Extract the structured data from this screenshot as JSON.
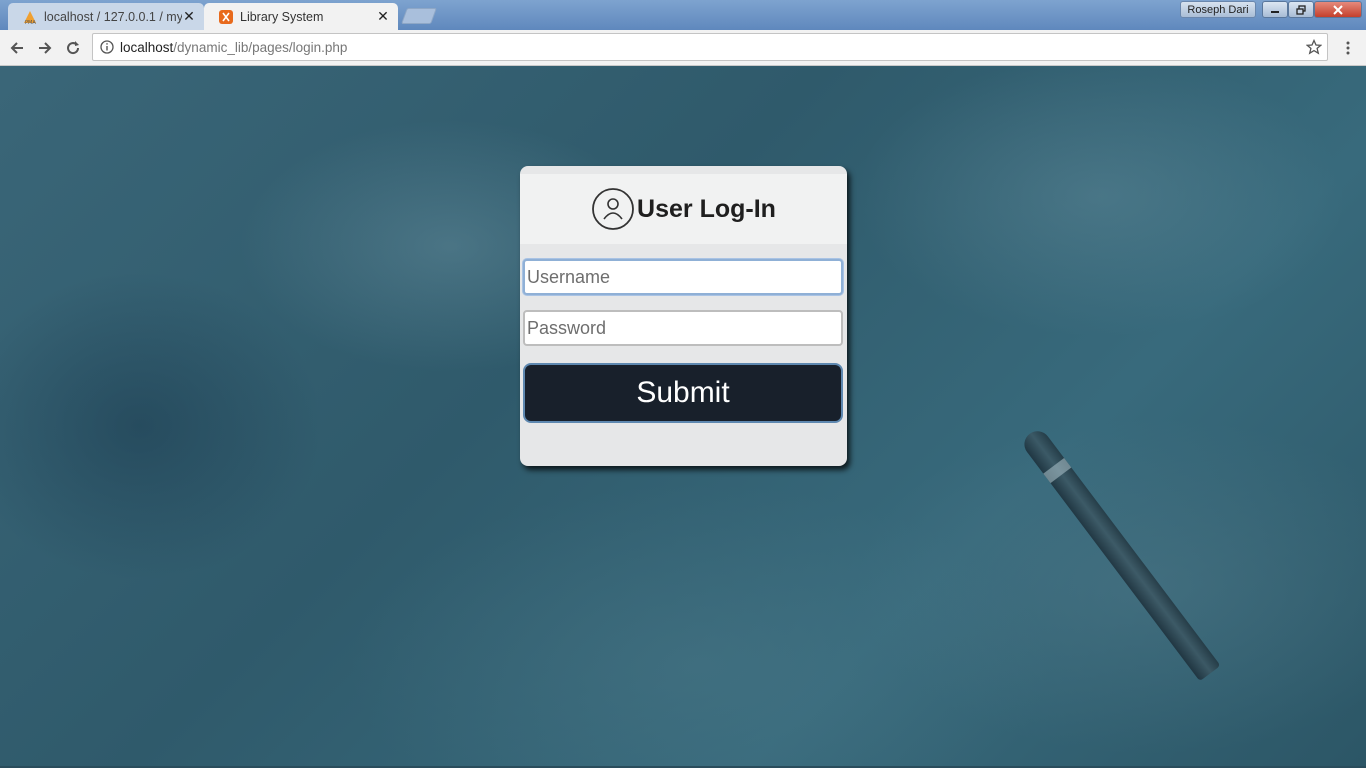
{
  "browser": {
    "tabs": [
      {
        "title": "localhost / 127.0.0.1 / my",
        "active": false,
        "icon": "phpmyadmin-icon"
      },
      {
        "title": "Library System",
        "active": true,
        "icon": "xampp-icon"
      }
    ],
    "profile_name": "Roseph Dari",
    "address": {
      "host": "localhost",
      "path": "/dynamic_lib/pages/login.php"
    }
  },
  "login": {
    "title": "User Log-In",
    "username_placeholder": "Username",
    "password_placeholder": "Password",
    "submit_label": "Submit"
  },
  "colors": {
    "card_background": "#e6e7e8",
    "button_background": "#18202b",
    "page_tint": "#2e5666"
  }
}
